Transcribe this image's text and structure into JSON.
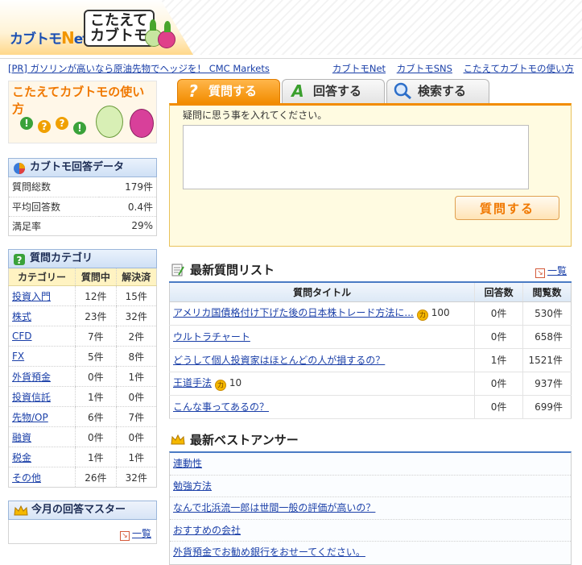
{
  "header": {
    "logo_main_prefix": "カブトモ",
    "logo_main_n": "N",
    "logo_main_suffix": "et",
    "logo_sub_line1": "こたえて",
    "logo_sub_line2": "カブトモ"
  },
  "topbar": {
    "pr_text": "[PR] ガソリンが高いなら原油先物でヘッジを！ CMC Markets",
    "nav": [
      "カブトモNet",
      "カブトモSNS",
      "こたえてカブトモの使い方"
    ]
  },
  "banner": {
    "title": "こたえてカブトモの使い方",
    "bubbles": [
      "!",
      "?",
      "?",
      "!"
    ]
  },
  "stats": {
    "heading": "カブトモ回答データ",
    "rows": [
      {
        "label": "質問総数",
        "value": "179件"
      },
      {
        "label": "平均回答数",
        "value": "0.4件"
      },
      {
        "label": "満足率",
        "value": "29%"
      }
    ]
  },
  "categories": {
    "heading": "質問カテゴリ",
    "columns": [
      "カテゴリー",
      "質問中",
      "解決済"
    ],
    "rows": [
      {
        "name": "投資入門",
        "open": "12件",
        "solved": "15件"
      },
      {
        "name": "株式",
        "open": "23件",
        "solved": "32件"
      },
      {
        "name": "CFD",
        "open": "7件",
        "solved": "2件"
      },
      {
        "name": "FX",
        "open": "5件",
        "solved": "8件"
      },
      {
        "name": "外貨預金",
        "open": "0件",
        "solved": "1件"
      },
      {
        "name": "投資信託",
        "open": "1件",
        "solved": "0件"
      },
      {
        "name": "先物/OP",
        "open": "6件",
        "solved": "7件"
      },
      {
        "name": "融資",
        "open": "0件",
        "solved": "0件"
      },
      {
        "name": "税金",
        "open": "1件",
        "solved": "1件"
      },
      {
        "name": "その他",
        "open": "26件",
        "solved": "32件"
      }
    ]
  },
  "master": {
    "heading": "今月の回答マスター",
    "more": "一覧"
  },
  "tabs": {
    "ask": "質問する",
    "answer": "回答する",
    "search": "検索する"
  },
  "ask_panel": {
    "prompt": "疑問に思う事を入れてください。",
    "textarea_value": "",
    "submit": "質問する"
  },
  "latest": {
    "heading": "最新質問リスト",
    "more": "一覧",
    "columns": [
      "質問タイトル",
      "回答数",
      "閲覧数"
    ],
    "rows": [
      {
        "title": "アメリカ国債格付け下げた後の日本株トレード方法に...",
        "coin": "100",
        "answers": "0件",
        "views": "530件"
      },
      {
        "title": "ウルトラチャート",
        "coin": "",
        "answers": "0件",
        "views": "658件"
      },
      {
        "title": "どうして個人投資家はほとんどの人が損するの？",
        "coin": "",
        "answers": "1件",
        "views": "1521件"
      },
      {
        "title": "王道手法",
        "coin": "10",
        "answers": "0件",
        "views": "937件"
      },
      {
        "title": "こんな事ってあるの？",
        "coin": "",
        "answers": "0件",
        "views": "699件"
      }
    ],
    "coin_glyph": "カ"
  },
  "best": {
    "heading": "最新ベストアンサー",
    "items": [
      "連動性",
      "勉強方法",
      "なんで北浜流一郎は世間一般の評価が高いの？",
      "おすすめの会社",
      "外貨預金でお勧め銀行をおせーてください。"
    ]
  },
  "colors": {
    "accent_orange": "#f28c00",
    "link_blue": "#1a3fa8",
    "header_blue": "#4a7bc4"
  }
}
